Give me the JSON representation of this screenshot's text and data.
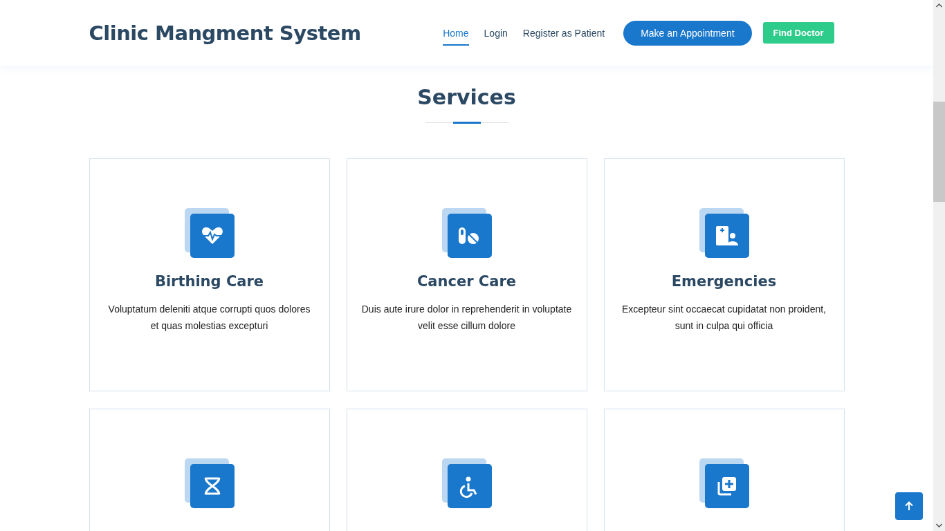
{
  "header": {
    "logo": "Clinic Mangment System",
    "nav": [
      {
        "label": "Home",
        "selected": true
      },
      {
        "label": "Login",
        "selected": false
      },
      {
        "label": "Register as Patient",
        "selected": false
      }
    ],
    "appointment_button": "Make an Appointment",
    "find_doctor_button": "Find Doctor"
  },
  "services": {
    "title": "Services",
    "cards": [
      {
        "kind": "heart",
        "title": "Birthing Care",
        "text": "Voluptatum deleniti atque corrupti quos dolores et quas molestias excepturi"
      },
      {
        "kind": "pills",
        "title": "Cancer Care",
        "text": "Duis aute irure dolor in reprehenderit in voluptate velit esse cillum dolore"
      },
      {
        "kind": "doctor",
        "title": "Emergencies",
        "text": "Excepteur sint occaecat cupidatat non proident, sunt in culpa qui officia"
      },
      {
        "kind": "dna"
      },
      {
        "kind": "wheelchair"
      },
      {
        "kind": "plus"
      }
    ]
  }
}
